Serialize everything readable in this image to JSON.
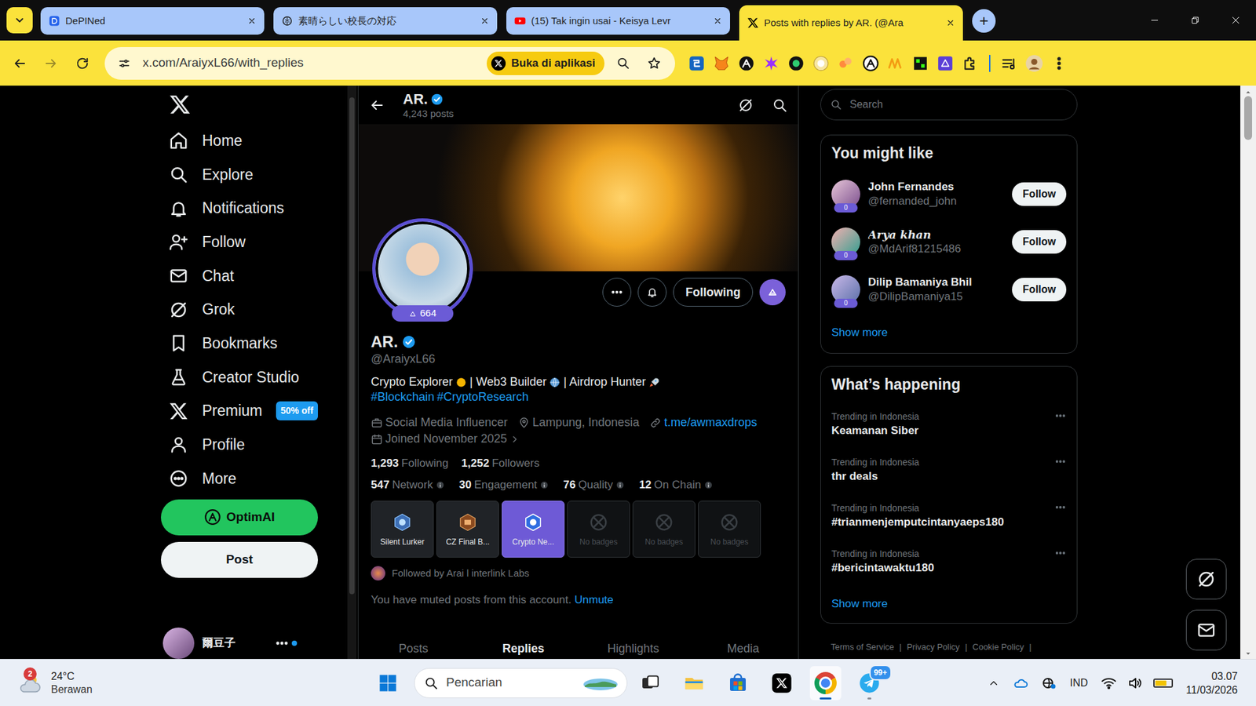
{
  "browser": {
    "tabs": [
      {
        "label": "DePINed",
        "selected": false
      },
      {
        "label": "素晴らしい校長の対応",
        "selected": false
      },
      {
        "label": "(15) Tak ingin usai - Keisya Levr",
        "selected": false
      },
      {
        "label": "Posts with replies by AR. (@Ara",
        "selected": true
      }
    ],
    "new_tab": "+",
    "address": "x.com/AraiyxL66/with_replies",
    "open_in_app": "Buka di aplikasi"
  },
  "x": {
    "nav": [
      {
        "label": "Home"
      },
      {
        "label": "Explore"
      },
      {
        "label": "Notifications"
      },
      {
        "label": "Follow"
      },
      {
        "label": "Chat"
      },
      {
        "label": "Grok"
      },
      {
        "label": "Bookmarks"
      },
      {
        "label": "Creator Studio"
      },
      {
        "label": "Premium",
        "badge": "50% off"
      },
      {
        "label": "Profile"
      },
      {
        "label": "More"
      }
    ],
    "optimai": "OptimAI",
    "post": "Post",
    "account_name": "爾豆子",
    "header": {
      "name": "AR.",
      "posts": "4,243 posts"
    },
    "profile": {
      "avatar_badge": "664",
      "following_button": "Following",
      "name": "AR.",
      "handle": "@AraiyxL66",
      "bio": [
        "Crypto Explorer",
        "| Web3 Builder",
        "| Airdrop Hunter"
      ],
      "hashtags": [
        "#Blockchain",
        "#CryptoResearch"
      ],
      "category": "Social Media Influencer",
      "location": "Lampung, Indonesia",
      "link": "t.me/awmaxdrops",
      "joined": "Joined November 2025",
      "stats": [
        {
          "value": "1,293",
          "label": "Following"
        },
        {
          "value": "1,252",
          "label": "Followers"
        }
      ],
      "scores": [
        {
          "value": "547",
          "label": "Network"
        },
        {
          "value": "30",
          "label": "Engagement"
        },
        {
          "value": "76",
          "label": "Quality"
        },
        {
          "value": "12",
          "label": "On Chain"
        }
      ],
      "badges": [
        {
          "label": "Silent Lurker",
          "kind": "earned",
          "selected": false
        },
        {
          "label": "CZ Final B...",
          "kind": "earned",
          "selected": false
        },
        {
          "label": "Crypto Ne...",
          "kind": "earned",
          "selected": true
        },
        {
          "label": "No badges",
          "kind": "empty",
          "selected": false
        },
        {
          "label": "No badges",
          "kind": "empty",
          "selected": false
        },
        {
          "label": "No badges",
          "kind": "empty",
          "selected": false
        }
      ],
      "followed_by": "Followed by Arai l interlink Labs",
      "muted": "You have muted posts from this account.",
      "unmute": "Unmute",
      "tabs": [
        {
          "label": "Posts",
          "selected": false
        },
        {
          "label": "Replies",
          "selected": true
        },
        {
          "label": "Highlights",
          "selected": false
        },
        {
          "label": "Media",
          "selected": false
        }
      ]
    },
    "sidebar": {
      "search_placeholder": "Search",
      "might_like_title": "You might like",
      "suggestions": [
        {
          "name": "John Fernandes",
          "handle": "@fernanded_john",
          "score": "0",
          "button": "Follow"
        },
        {
          "name": "Arya khan",
          "handle": "@MdArif81215486",
          "score": "0",
          "button": "Follow"
        },
        {
          "name": "Dilip Bamaniya Bhil",
          "handle": "@DilipBamaniya15",
          "score": "0",
          "button": "Follow"
        }
      ],
      "might_like_more": "Show more",
      "happening_title": "What’s happening",
      "trends": [
        {
          "context": "Trending in Indonesia",
          "title": "Keamanan Siber"
        },
        {
          "context": "Trending in Indonesia",
          "title": "thr deals"
        },
        {
          "context": "Trending in Indonesia",
          "title": "#trianmenjemputcintanyaeps180"
        },
        {
          "context": "Trending in Indonesia",
          "title": "#bericintawaktu180"
        }
      ],
      "happening_more": "Show more",
      "footer": {
        "links": [
          "Terms of Service",
          "Privacy Policy",
          "Cookie Policy"
        ],
        "separator": "|"
      }
    }
  },
  "taskbar": {
    "weather_alert": "2",
    "temperature": "24°C",
    "condition": "Berawan",
    "search_placeholder": "Pencarian",
    "apps": [
      {
        "kind": "task-view",
        "selected": false,
        "running": false
      },
      {
        "kind": "files",
        "selected": false,
        "running": false
      },
      {
        "kind": "store",
        "selected": false,
        "running": false
      },
      {
        "kind": "x",
        "selected": false,
        "running": false
      },
      {
        "kind": "chrome",
        "selected": true,
        "running": true
      },
      {
        "kind": "telegram",
        "selected": false,
        "running": true,
        "badge": "99+"
      }
    ],
    "language": "IND",
    "battery_level": 0.7,
    "time": "03.07",
    "date": "11/03/2026"
  }
}
